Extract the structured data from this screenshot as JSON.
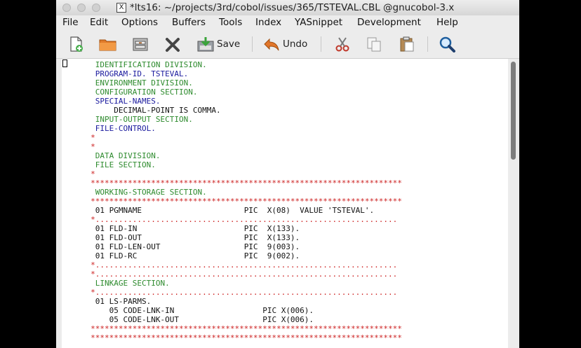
{
  "window": {
    "title": "*lts16: ~/projects/3rd/cobol/issues/365/TSTEVAL.CBL @gnucobol-3.x",
    "title_icon": "X"
  },
  "menu": [
    "File",
    "Edit",
    "Options",
    "Buffers",
    "Tools",
    "Index",
    "YASnippet",
    "Development",
    "Help"
  ],
  "toolbar": {
    "save_label": "Save",
    "undo_label": "Undo"
  },
  "code_lines": [
    {
      "text": "IDENTIFICATION DIVISION.",
      "cls": "sec",
      "indent": 6
    },
    {
      "text": "PROGRAM-ID. TSTEVAL.",
      "cls": "kw",
      "indent": 6
    },
    {
      "text": "ENVIRONMENT DIVISION.",
      "cls": "sec",
      "indent": 6
    },
    {
      "text": "CONFIGURATION SECTION.",
      "cls": "sec",
      "indent": 6
    },
    {
      "text": "SPECIAL-NAMES.",
      "cls": "kw",
      "indent": 6
    },
    {
      "text": "DECIMAL-POINT IS COMMA.",
      "cls": "",
      "indent": 10
    },
    {
      "text": "INPUT-OUTPUT SECTION.",
      "cls": "sec",
      "indent": 6
    },
    {
      "text": "FILE-CONTROL.",
      "cls": "kw",
      "indent": 6
    },
    {
      "text": "*",
      "cls": "star",
      "indent": 5
    },
    {
      "text": "*",
      "cls": "star",
      "indent": 5
    },
    {
      "text": "DATA DIVISION.",
      "cls": "sec",
      "indent": 6
    },
    {
      "text": "FILE SECTION.",
      "cls": "sec",
      "indent": 6
    },
    {
      "text": "*",
      "cls": "star",
      "indent": 5
    },
    {
      "text": "*******************************************************************",
      "cls": "star",
      "indent": 5
    },
    {
      "text": "WORKING-STORAGE SECTION.",
      "cls": "sec",
      "indent": 6
    },
    {
      "text": "*******************************************************************",
      "cls": "star",
      "indent": 5
    },
    {
      "text": "01 PGMNAME                      PIC  X(08)  VALUE 'TSTEVAL'.",
      "cls": "",
      "indent": 6
    },
    {
      "text": "*.................................................................",
      "cls": "star",
      "indent": 5
    },
    {
      "text": "01 FLD-IN                       PIC  X(133).",
      "cls": "",
      "indent": 6
    },
    {
      "text": "01 FLD-OUT                      PIC  X(133).",
      "cls": "",
      "indent": 6
    },
    {
      "text": "01 FLD-LEN-OUT                  PIC  9(003).",
      "cls": "",
      "indent": 6
    },
    {
      "text": "01 FLD-RC                       PIC  9(002).",
      "cls": "",
      "indent": 6
    },
    {
      "text": "*.................................................................",
      "cls": "star",
      "indent": 5
    },
    {
      "text": "*.................................................................",
      "cls": "star",
      "indent": 5
    },
    {
      "text": "LINKAGE SECTION.",
      "cls": "sec",
      "indent": 6
    },
    {
      "text": "*.................................................................",
      "cls": "star",
      "indent": 5
    },
    {
      "text": "01 LS-PARMS.",
      "cls": "",
      "indent": 6
    },
    {
      "text": "05 CODE-LNK-IN                   PIC X(006).",
      "cls": "",
      "indent": 9
    },
    {
      "text": "05 CODE-LNK-OUT                  PIC X(006).",
      "cls": "",
      "indent": 9
    },
    {
      "text": "*******************************************************************",
      "cls": "star",
      "indent": 5
    },
    {
      "text": "*******************************************************************",
      "cls": "star",
      "indent": 5
    }
  ]
}
